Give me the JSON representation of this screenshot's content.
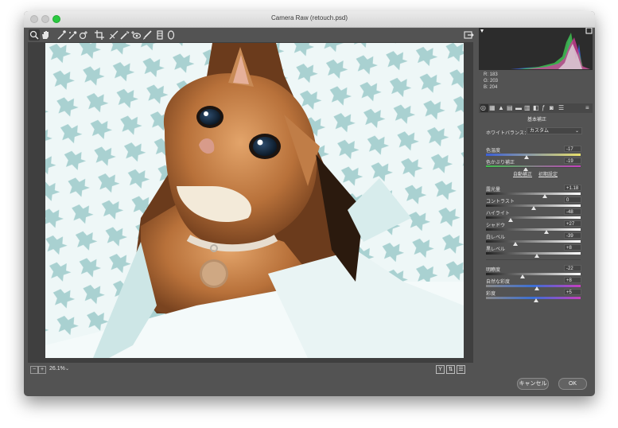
{
  "window": {
    "title": "Camera Raw (retouch.psd)"
  },
  "toolbar": {
    "tools": [
      "zoom-icon",
      "hand-icon",
      "white-balance-icon",
      "color-sampler-icon",
      "targeted-adjust-icon",
      "crop-icon",
      "straighten-icon",
      "spot-removal-icon",
      "red-eye-icon",
      "brush-icon",
      "graduated-filter-icon",
      "radial-filter-icon"
    ],
    "export_icon": "export-icon"
  },
  "status": {
    "zoom": "26.1%",
    "zoom_minus": "−",
    "zoom_plus": "+",
    "zoom_dropdown": "⌄",
    "view_y": "Y",
    "view_compare": "⇅",
    "view_menu": "☰"
  },
  "histogram": {
    "r": "R:  183",
    "g": "G:  203",
    "b": "B:  204"
  },
  "panel": {
    "title": "基本補正",
    "white_balance_label": "ホワイトバランス：",
    "white_balance_value": "カスタム",
    "auto_link": "自動補正",
    "default_link": "初期設定",
    "sliders": [
      {
        "label": "色温度",
        "value": "-17",
        "pos": 0.43
      },
      {
        "label": "色かぶり補正",
        "value": "-19",
        "pos": 0.42
      },
      {
        "label": "露光量",
        "value": "+1.18",
        "pos": 0.62
      },
      {
        "label": "コントラスト",
        "value": "0",
        "pos": 0.5
      },
      {
        "label": "ハイライト",
        "value": "-48",
        "pos": 0.26
      },
      {
        "label": "シャドウ",
        "value": "+27",
        "pos": 0.64
      },
      {
        "label": "白レベル",
        "value": "-39",
        "pos": 0.31
      },
      {
        "label": "黒レベル",
        "value": "+8",
        "pos": 0.54
      },
      {
        "label": "明瞭度",
        "value": "-22",
        "pos": 0.39
      },
      {
        "label": "自然な彩度",
        "value": "+8",
        "pos": 0.54
      },
      {
        "label": "彩度",
        "value": "+5",
        "pos": 0.53
      }
    ]
  },
  "buttons": {
    "cancel": "キャンセル",
    "ok": "OK"
  }
}
